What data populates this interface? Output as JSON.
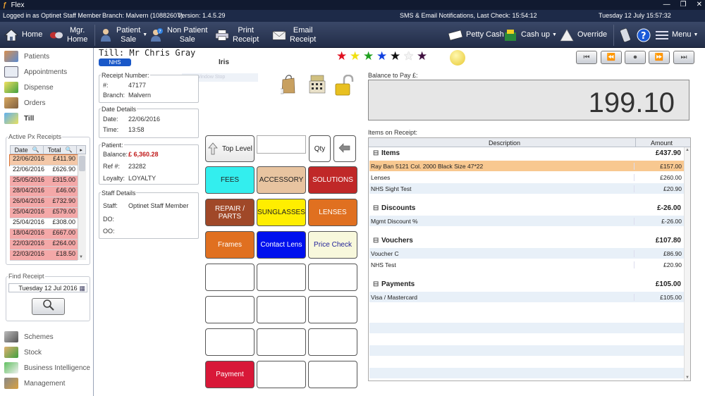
{
  "app": {
    "title": "Flex"
  },
  "infobar": {
    "logged_in": "Logged in as Optinet Staff Member",
    "branch": "Branch: Malvern (10882607)",
    "version": "Version: 1.4.5.29",
    "notifications": "SMS & Email Notifications, Last Check: 15:54:12",
    "datetime": "Tuesday 12 July 15:57:32"
  },
  "toolbar": {
    "home": "Home",
    "mgr_home_1": "Mgr.",
    "mgr_home_2": "Home",
    "patient_sale_1": "Patient",
    "patient_sale_2": "Sale",
    "non_patient_sale_1": "Non Patient",
    "non_patient_sale_2": "Sale",
    "print_receipt_1": "Print",
    "print_receipt_2": "Receipt",
    "email_receipt_1": "Email",
    "email_receipt_2": "Receipt",
    "petty_cash": "Petty Cash",
    "cash_up": "Cash up",
    "override": "Override",
    "menu": "Menu"
  },
  "sidebar": {
    "items": [
      {
        "label": "Patients",
        "icon": "patients-icon"
      },
      {
        "label": "Appointments",
        "icon": "calendar-icon"
      },
      {
        "label": "Dispense",
        "icon": "glasses-icon"
      },
      {
        "label": "Orders",
        "icon": "orders-icon"
      },
      {
        "label": "Till",
        "icon": "till-icon"
      }
    ],
    "bottom_items": [
      {
        "label": "Schemes",
        "icon": "schemes-icon"
      },
      {
        "label": "Stock",
        "icon": "stock-icon"
      },
      {
        "label": "Business Intelligence",
        "icon": "chart-icon"
      },
      {
        "label": "Management",
        "icon": "management-icon"
      }
    ],
    "active_px_title": "Active Px Receipts",
    "col_date": "Date",
    "col_total": "Total",
    "receipts": [
      {
        "date": "22/06/2016",
        "total": "£411.90",
        "color": "#f4c8a8"
      },
      {
        "date": "22/06/2016",
        "total": "£626.90",
        "color": "#ffffff"
      },
      {
        "date": "25/05/2016",
        "total": "£315.00",
        "color": "#f4a8a8"
      },
      {
        "date": "28/04/2016",
        "total": "£46.00",
        "color": "#f4a8a8"
      },
      {
        "date": "26/04/2016",
        "total": "£732.90",
        "color": "#f4a8a8"
      },
      {
        "date": "25/04/2016",
        "total": "£579.00",
        "color": "#f4a8a8"
      },
      {
        "date": "25/04/2016",
        "total": "£308.00",
        "color": "#ffffff"
      },
      {
        "date": "18/04/2016",
        "total": "£667.00",
        "color": "#f4a8a8"
      },
      {
        "date": "22/03/2016",
        "total": "£264.00",
        "color": "#f4a8a8"
      },
      {
        "date": "22/03/2016",
        "total": "£18.50",
        "color": "#f4a8a8"
      }
    ],
    "find_receipt_title": "Find Receipt",
    "find_date": "Tuesday 12 Jul 2016"
  },
  "till": {
    "title": "Till: Mr Chris Gray",
    "badge": "NHS",
    "subname": "Iris",
    "window_stop": "Window Stop"
  },
  "receipt": {
    "number_title": "Receipt Number:",
    "num_label": "#:",
    "num_value": "47177",
    "branch_label": "Branch:",
    "branch_value": "Malvern",
    "date_title": "Date Details",
    "date_label": "Date:",
    "date_value": "22/06/2016",
    "time_label": "Time:",
    "time_value": "13:58",
    "patient_title": "Patient:",
    "balance_label": "Balance:",
    "balance_value": "£ 6,360.28",
    "ref_label": "Ref #:",
    "ref_value": "23282",
    "loyalty_label": "Loyalty:",
    "loyalty_value": "LOYALTY",
    "staff_title": "Staff Details",
    "staff_label": "Staff:",
    "staff_value": "Optinet Staff Member",
    "do_label": "DO:",
    "oo_label": "OO:"
  },
  "buttons": {
    "top_level": "Top Level",
    "qty": "Qty",
    "grid": [
      {
        "label": "FEES",
        "bg": "#33eeee",
        "fg": "#222"
      },
      {
        "label": "ACCESSORY",
        "bg": "#e8c4a0",
        "fg": "#222"
      },
      {
        "label": "SOLUTIONS",
        "bg": "#c02828",
        "fg": "#fff"
      },
      {
        "label": "REPAIR / PARTS",
        "bg": "#a04828",
        "fg": "#fff"
      },
      {
        "label": "SUNGLASSES",
        "bg": "#ffee00",
        "fg": "#222"
      },
      {
        "label": "LENSES",
        "bg": "#e07020",
        "fg": "#fff"
      },
      {
        "label": "Frames",
        "bg": "#e07020",
        "fg": "#fff"
      },
      {
        "label": "Contact Lens",
        "bg": "#0010ee",
        "fg": "#fff"
      },
      {
        "label": "Price Check",
        "bg": "#f8f8dc",
        "fg": "#222299"
      }
    ],
    "payment": "Payment"
  },
  "balance": {
    "label": "Balance to Pay £:",
    "value": "199.10"
  },
  "items_on_receipt": {
    "title": "Items on Receipt:",
    "col_desc": "Description",
    "col_amount": "Amount",
    "groups": [
      {
        "name": "Items",
        "total": "£437.90",
        "rows": [
          {
            "desc": "Ray Ban 5121 Col. 2000 Black Size 47*22",
            "amount": "£157.00"
          },
          {
            "desc": "Lenses",
            "amount": "£260.00"
          },
          {
            "desc": "NHS Sight Test",
            "amount": "£20.90"
          }
        ]
      },
      {
        "name": "Discounts",
        "total": "£-26.00",
        "rows": [
          {
            "desc": "Mgmt Discount %",
            "amount": "£-26.00"
          }
        ]
      },
      {
        "name": "Vouchers",
        "total": "£107.80",
        "rows": [
          {
            "desc": "Voucher C",
            "amount": "£86.90"
          },
          {
            "desc": "NHS Test",
            "amount": "£20.90"
          }
        ]
      },
      {
        "name": "Payments",
        "total": "£105.00",
        "rows": [
          {
            "desc": "Visa / Mastercard",
            "amount": "£105.00"
          }
        ]
      }
    ]
  },
  "colors": {
    "selected_row": "#f8c890",
    "alt_row": "#e8f0f8",
    "toolbar": "#2a3655"
  }
}
